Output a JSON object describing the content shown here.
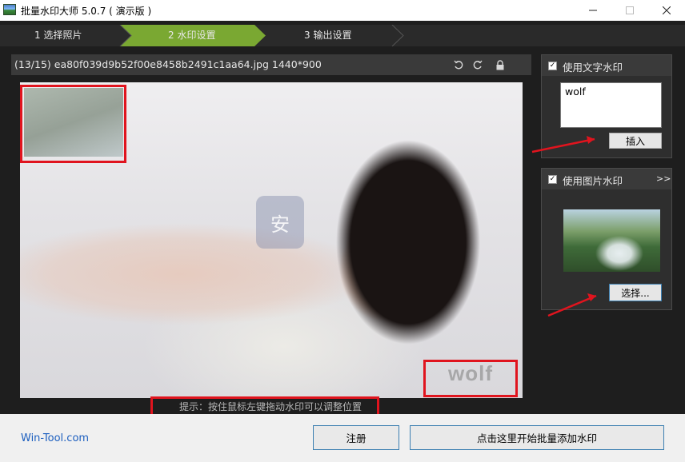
{
  "window": {
    "title": "批量水印大师 5.0.7 ( 演示版 )",
    "minimize_icon": "minimize-icon",
    "maximize_icon": "maximize-icon",
    "close_icon": "close-icon"
  },
  "steps": [
    {
      "label": "1 选择照片",
      "active": false
    },
    {
      "label": "2 水印设置",
      "active": true
    },
    {
      "label": "3 输出设置",
      "active": false
    }
  ],
  "file_bar": {
    "info": "(13/15) ea80f039d9b52f00e8458b2491c1aa64.jpg 1440*900",
    "icons": [
      "rotate-left-icon",
      "rotate-right-icon",
      "lock-icon"
    ]
  },
  "preview": {
    "watermark_text": "wolf",
    "hint": "提示：按住鼠标左键拖动水印可以调整位置"
  },
  "text_watermark": {
    "checked": true,
    "title": "使用文字水印",
    "value": "wolf",
    "insert_label": "插入"
  },
  "image_watermark": {
    "checked": true,
    "title": "使用图片水印",
    "expand_label": ">>",
    "select_label": "选择..."
  },
  "bottom": {
    "brand": "Win-Tool.com",
    "register_label": "注册",
    "start_label": "点击这里开始批量添加水印"
  },
  "colors": {
    "active_step": "#7aa832",
    "annotation_red": "#e0141e",
    "dark_bg": "#1e1e1e",
    "brand_link": "#1d5fbf"
  }
}
